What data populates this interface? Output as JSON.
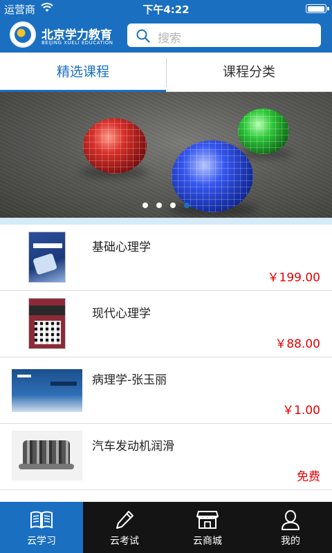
{
  "status_bar": {
    "carrier": "运营商",
    "time": "下午4:22",
    "battery_level": 0.9
  },
  "header": {
    "logo_cn": "北京学力教育",
    "logo_en": "BEIJING XUELI EDUCATION",
    "search_placeholder": "搜索"
  },
  "tabs": [
    {
      "label": "精选课程",
      "active": true
    },
    {
      "label": "课程分类",
      "active": false
    }
  ],
  "banner": {
    "dots": 4,
    "active_dot": 3
  },
  "courses": [
    {
      "title": "基础心理学",
      "price": "￥199.00",
      "thumb": "psychology-book-blue"
    },
    {
      "title": "现代心理学",
      "price": "￥88.00",
      "thumb": "psychology-book-red"
    },
    {
      "title": "病理学-张玉丽",
      "price": "￥1.00",
      "thumb": "pathology-book-blue"
    },
    {
      "title": "汽车发动机润滑",
      "price": "免费",
      "thumb": "engine-photo"
    }
  ],
  "tabbar": [
    {
      "label": "云学习",
      "icon": "book-icon",
      "active": true
    },
    {
      "label": "云考试",
      "icon": "pen-icon",
      "active": false
    },
    {
      "label": "云商城",
      "icon": "store-icon",
      "active": false
    },
    {
      "label": "我的",
      "icon": "user-icon",
      "active": false
    }
  ],
  "colors": {
    "primary": "#1a6fc0",
    "price": "#e60000",
    "tabbar_bg": "#141414",
    "divider_band": "#d6ebf7"
  }
}
